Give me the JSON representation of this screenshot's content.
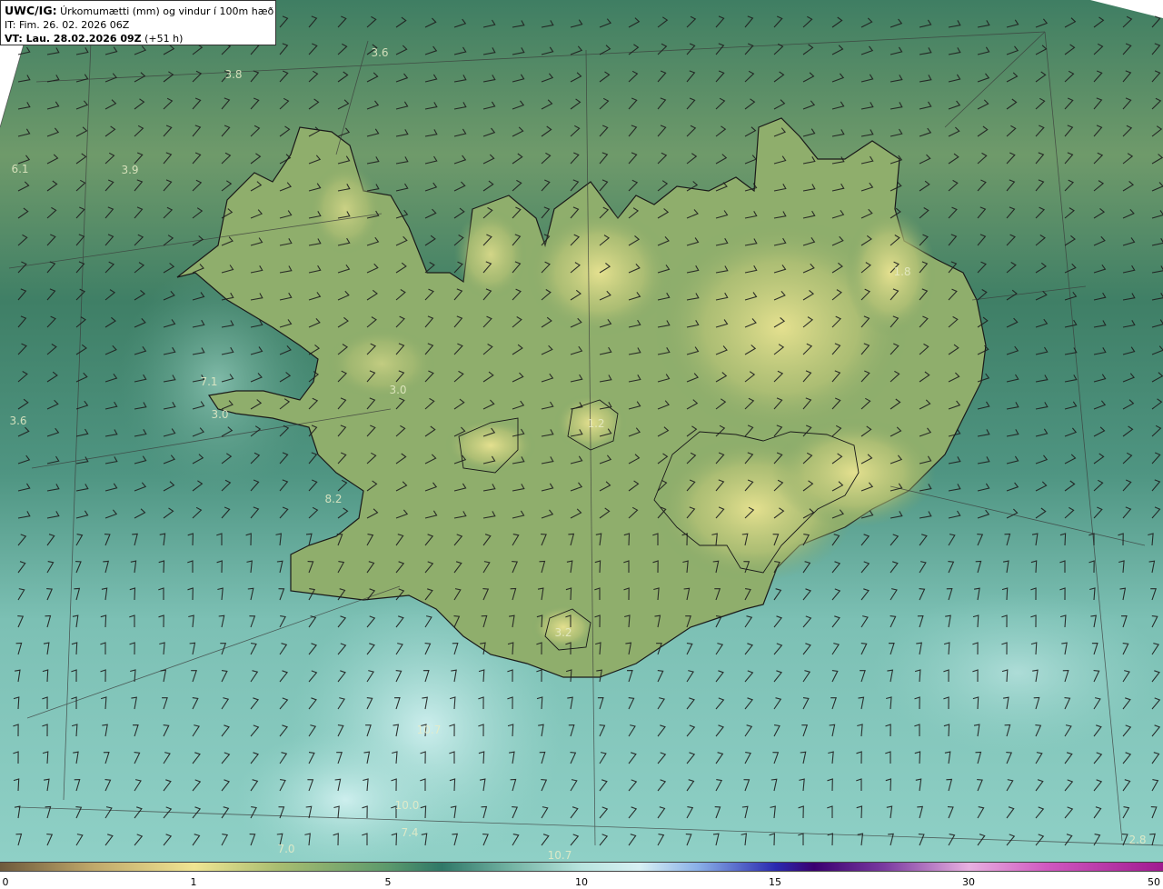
{
  "header": {
    "model": "UWC/IG:",
    "title": "Úrkomumætti (mm) og vindur í 100m hæð",
    "issue_time": "IT: Fim. 26. 02. 2026 06Z",
    "valid_prefix": "VT: Lau. 28.02.2026 09Z",
    "valid_suffix": "(+51 h)"
  },
  "max_labels": [
    "3.6",
    "3.8",
    "6.1",
    "3.9",
    "7.1",
    "3.6",
    "3.0",
    "3.0",
    "1.2",
    "1.8",
    "8.2",
    "3.2",
    "10.7",
    "10.0",
    "7.4",
    "7.0",
    "10.7",
    "2.8"
  ],
  "legend": {
    "unit": "mm",
    "ticks": [
      "0",
      "1",
      "5",
      "10",
      "15",
      "30",
      "50"
    ],
    "colors": [
      "#6e5a3c",
      "#f0e592",
      "#5c9a6c",
      "#b8e4de",
      "#2a2ab0",
      "#e8b0e0",
      "#a01a90"
    ]
  },
  "colors": {
    "land_high": "#e4df8c",
    "land_mid": "#9bb46e",
    "sea_north": "#4d8a66",
    "sea_south": "#86c8be",
    "coast": "#1a1a1a",
    "barb": "#1e1e1e"
  }
}
